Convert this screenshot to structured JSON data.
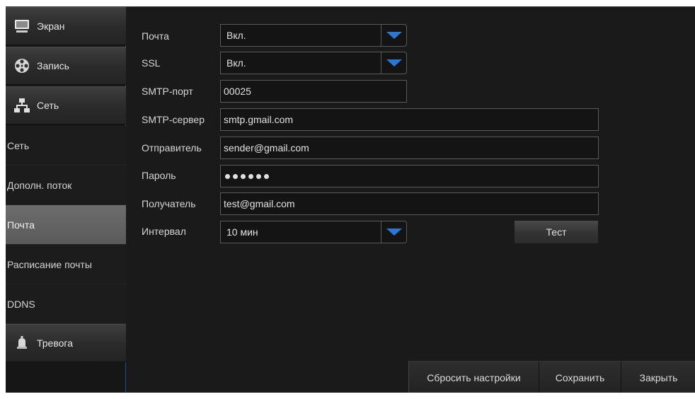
{
  "sidebar": {
    "categories": {
      "screen": "Экран",
      "record": "Запись",
      "network": "Сеть",
      "alarm": "Тревога"
    },
    "network_items": [
      "Сеть",
      "Дополн. поток",
      "Почта",
      "Расписание почты",
      "DDNS"
    ],
    "active_item": "Почта"
  },
  "form": {
    "mail": {
      "label": "Почта",
      "value": "Вкл."
    },
    "ssl": {
      "label": "SSL",
      "value": "Вкл."
    },
    "smtp_port": {
      "label": "SMTP-порт",
      "value": "00025"
    },
    "smtp_server": {
      "label": "SMTP-сервер",
      "value": "smtp.gmail.com"
    },
    "sender": {
      "label": "Отправитель",
      "value": "sender@gmail.com"
    },
    "password": {
      "label": "Пароль",
      "masked_length": 6
    },
    "recipient": {
      "label": "Получатель",
      "value": "test@gmail.com"
    },
    "interval": {
      "label": "Интервал",
      "value": "10 мин"
    },
    "test_button": "Тест"
  },
  "footer": {
    "reset": "Сбросить настройки",
    "save": "Сохранить",
    "close": "Закрыть"
  },
  "colors": {
    "accent_blue": "#2a78d6",
    "active_item_bg": "#666666",
    "panel_bg": "#1a1a1a"
  },
  "icons": {
    "screen": "monitor-icon",
    "record": "film-reel-icon",
    "network": "network-icon",
    "alarm": "bell-icon",
    "dropdown": "chevron-down-icon"
  }
}
